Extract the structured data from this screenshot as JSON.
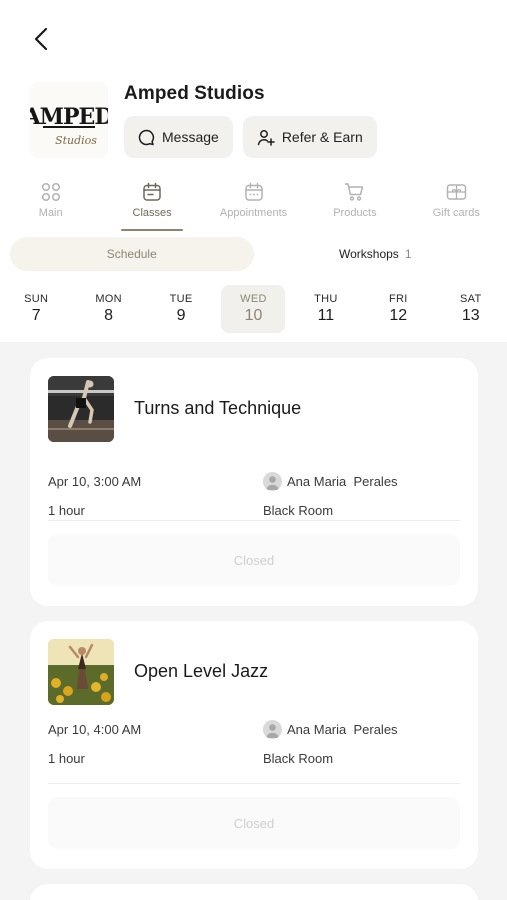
{
  "header": {
    "studio_name": "Amped Studios",
    "message_label": "Message",
    "refer_label": "Refer & Earn"
  },
  "logo": {
    "text_main": "AMPED",
    "text_script": "Studios"
  },
  "tabs": [
    {
      "label": "Main",
      "icon": "grid-icon",
      "active": false
    },
    {
      "label": "Classes",
      "icon": "calendar-icon",
      "active": true
    },
    {
      "label": "Appointments",
      "icon": "calendar-icon",
      "active": false
    },
    {
      "label": "Products",
      "icon": "cart-icon",
      "active": false
    },
    {
      "label": "Gift cards",
      "icon": "gift-icon",
      "active": false
    }
  ],
  "segments": {
    "schedule_label": "Schedule",
    "workshops_label": "Workshops",
    "workshops_count": "1"
  },
  "days": [
    {
      "name": "SUN",
      "date": "7"
    },
    {
      "name": "MON",
      "date": "8"
    },
    {
      "name": "TUE",
      "date": "9"
    },
    {
      "name": "WED",
      "date": "10",
      "selected": true
    },
    {
      "name": "THU",
      "date": "11"
    },
    {
      "name": "FRI",
      "date": "12"
    },
    {
      "name": "SAT",
      "date": "13"
    }
  ],
  "classes": [
    {
      "title": "Turns and Technique",
      "datetime": "Apr 10, 3:00 AM",
      "duration": "1 hour",
      "instructor": "Ana Maria  Perales",
      "room": "Black Room",
      "status": "Closed"
    },
    {
      "title": "Open Level Jazz",
      "datetime": "Apr 10, 4:00 AM",
      "duration": "1 hour",
      "instructor": "Ana Maria  Perales",
      "room": "Black Room",
      "status": "Closed"
    }
  ],
  "colors": {
    "accent": "#8c8672",
    "background": "#f4f4f4",
    "pill": "#f2f1ee"
  }
}
